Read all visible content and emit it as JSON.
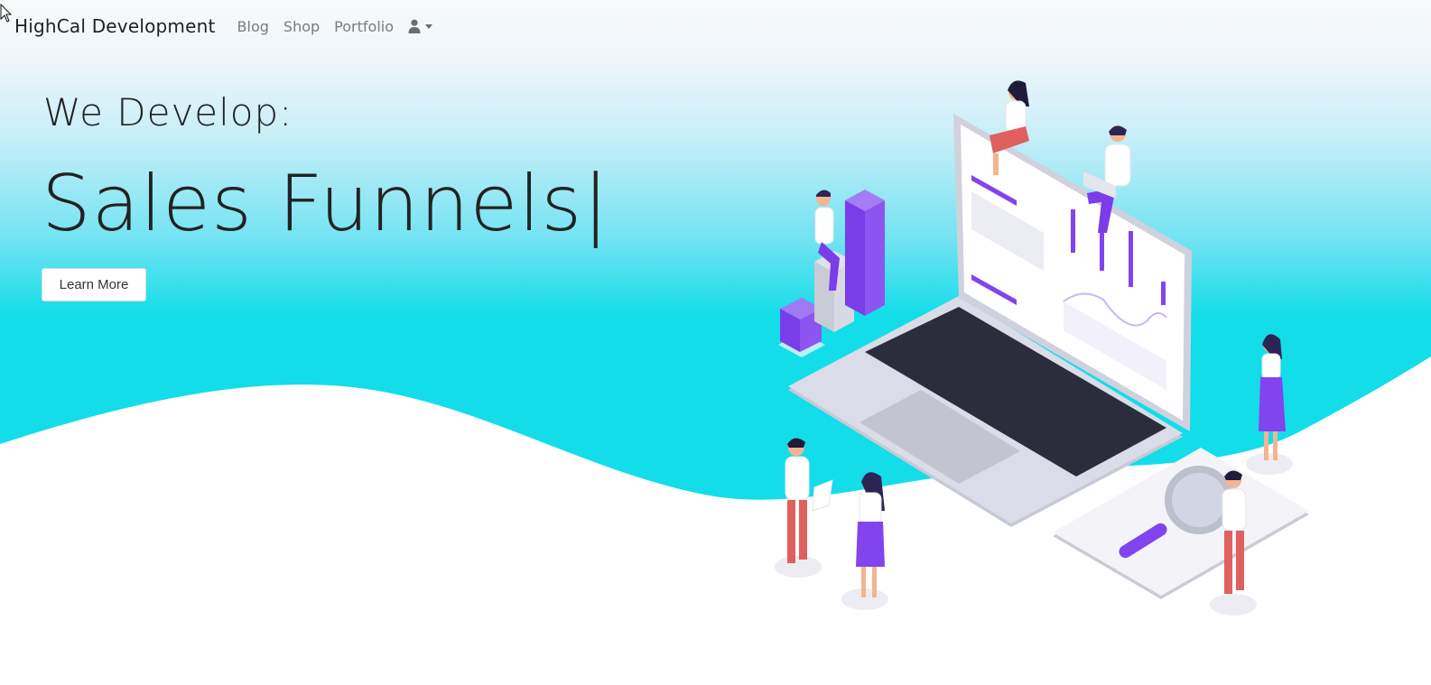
{
  "navbar": {
    "brand": "HighCal Development",
    "links": [
      "Blog",
      "Shop",
      "Portfolio"
    ],
    "user_icon": "user-icon",
    "caret_icon": "caret-down-icon"
  },
  "hero": {
    "intro": "We Develop:",
    "typed_word": "Sales Funnels|",
    "cta_label": "Learn More"
  },
  "colors": {
    "hero_top": "#f8f9fa",
    "hero_cyan": "#13dde9",
    "accent_purple": "#8244ee",
    "laptop": "#d4d6e2",
    "text_dark": "#222222",
    "nav_link": "#7b7b7b"
  },
  "illustration": {
    "icon": "isometric-laptop-team-illustration"
  }
}
